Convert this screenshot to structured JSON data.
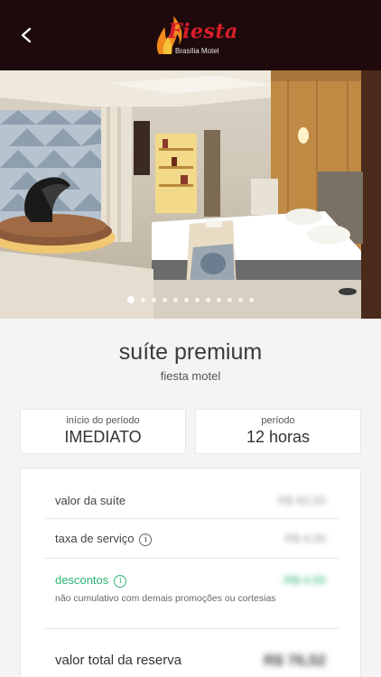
{
  "header": {
    "logo_title": "Fiesta",
    "logo_subtitle": "Brasília Motel",
    "brand_color": "#d91e2a",
    "background": "#1e0a0c"
  },
  "gallery": {
    "photo_count": 12,
    "active_index": 0
  },
  "suite": {
    "title": "suíte premium",
    "subtitle": "fiesta motel"
  },
  "period_start": {
    "label": "início do período",
    "value": "IMEDIATO"
  },
  "period": {
    "label": "período",
    "value": "12 horas"
  },
  "pricing": {
    "suite_label": "valor da suíte",
    "suite_value": "R$ 82,00",
    "service_label": "taxa de serviço",
    "service_value": "R$ 4,00",
    "discount_label": "descontos",
    "discount_value": "-R$ 4,00",
    "discount_note": "não cumulativo com demais promoções ou cortesias",
    "discount_color": "#2bb673",
    "total_label": "valor total da reserva",
    "total_value": "R$ 76,52"
  }
}
